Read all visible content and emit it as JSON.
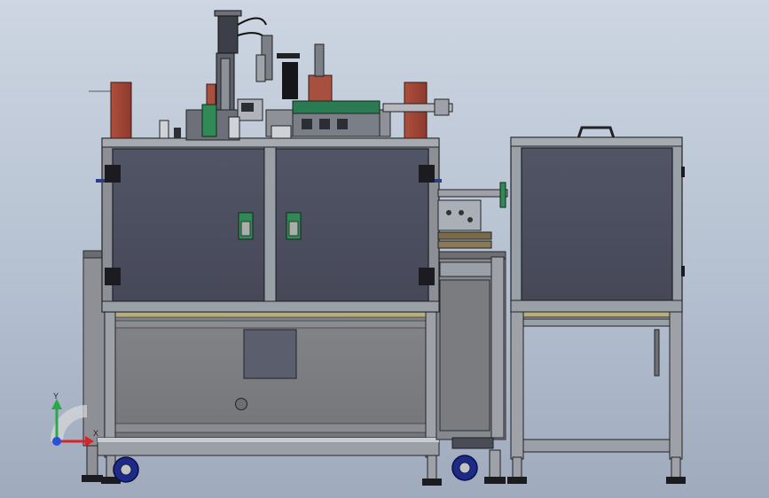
{
  "viewport": {
    "background_top": "#cdd6e2",
    "background_bottom": "#9fabbd"
  },
  "triad": {
    "x_label": "X",
    "y_label": "Y",
    "x_color": "#d8232a",
    "y_color": "#2aa84a",
    "z_color": "#2a4fd8"
  },
  "colors": {
    "frame": "#9aa0a8",
    "frame_dark": "#3a3d44",
    "panel": "#4d5060",
    "panel_edge": "#1f2028",
    "base_panel": "#7d7f82",
    "accent_red": "#a8503f",
    "accent_green": "#2f8a55",
    "caster": "#1c2a8c"
  }
}
